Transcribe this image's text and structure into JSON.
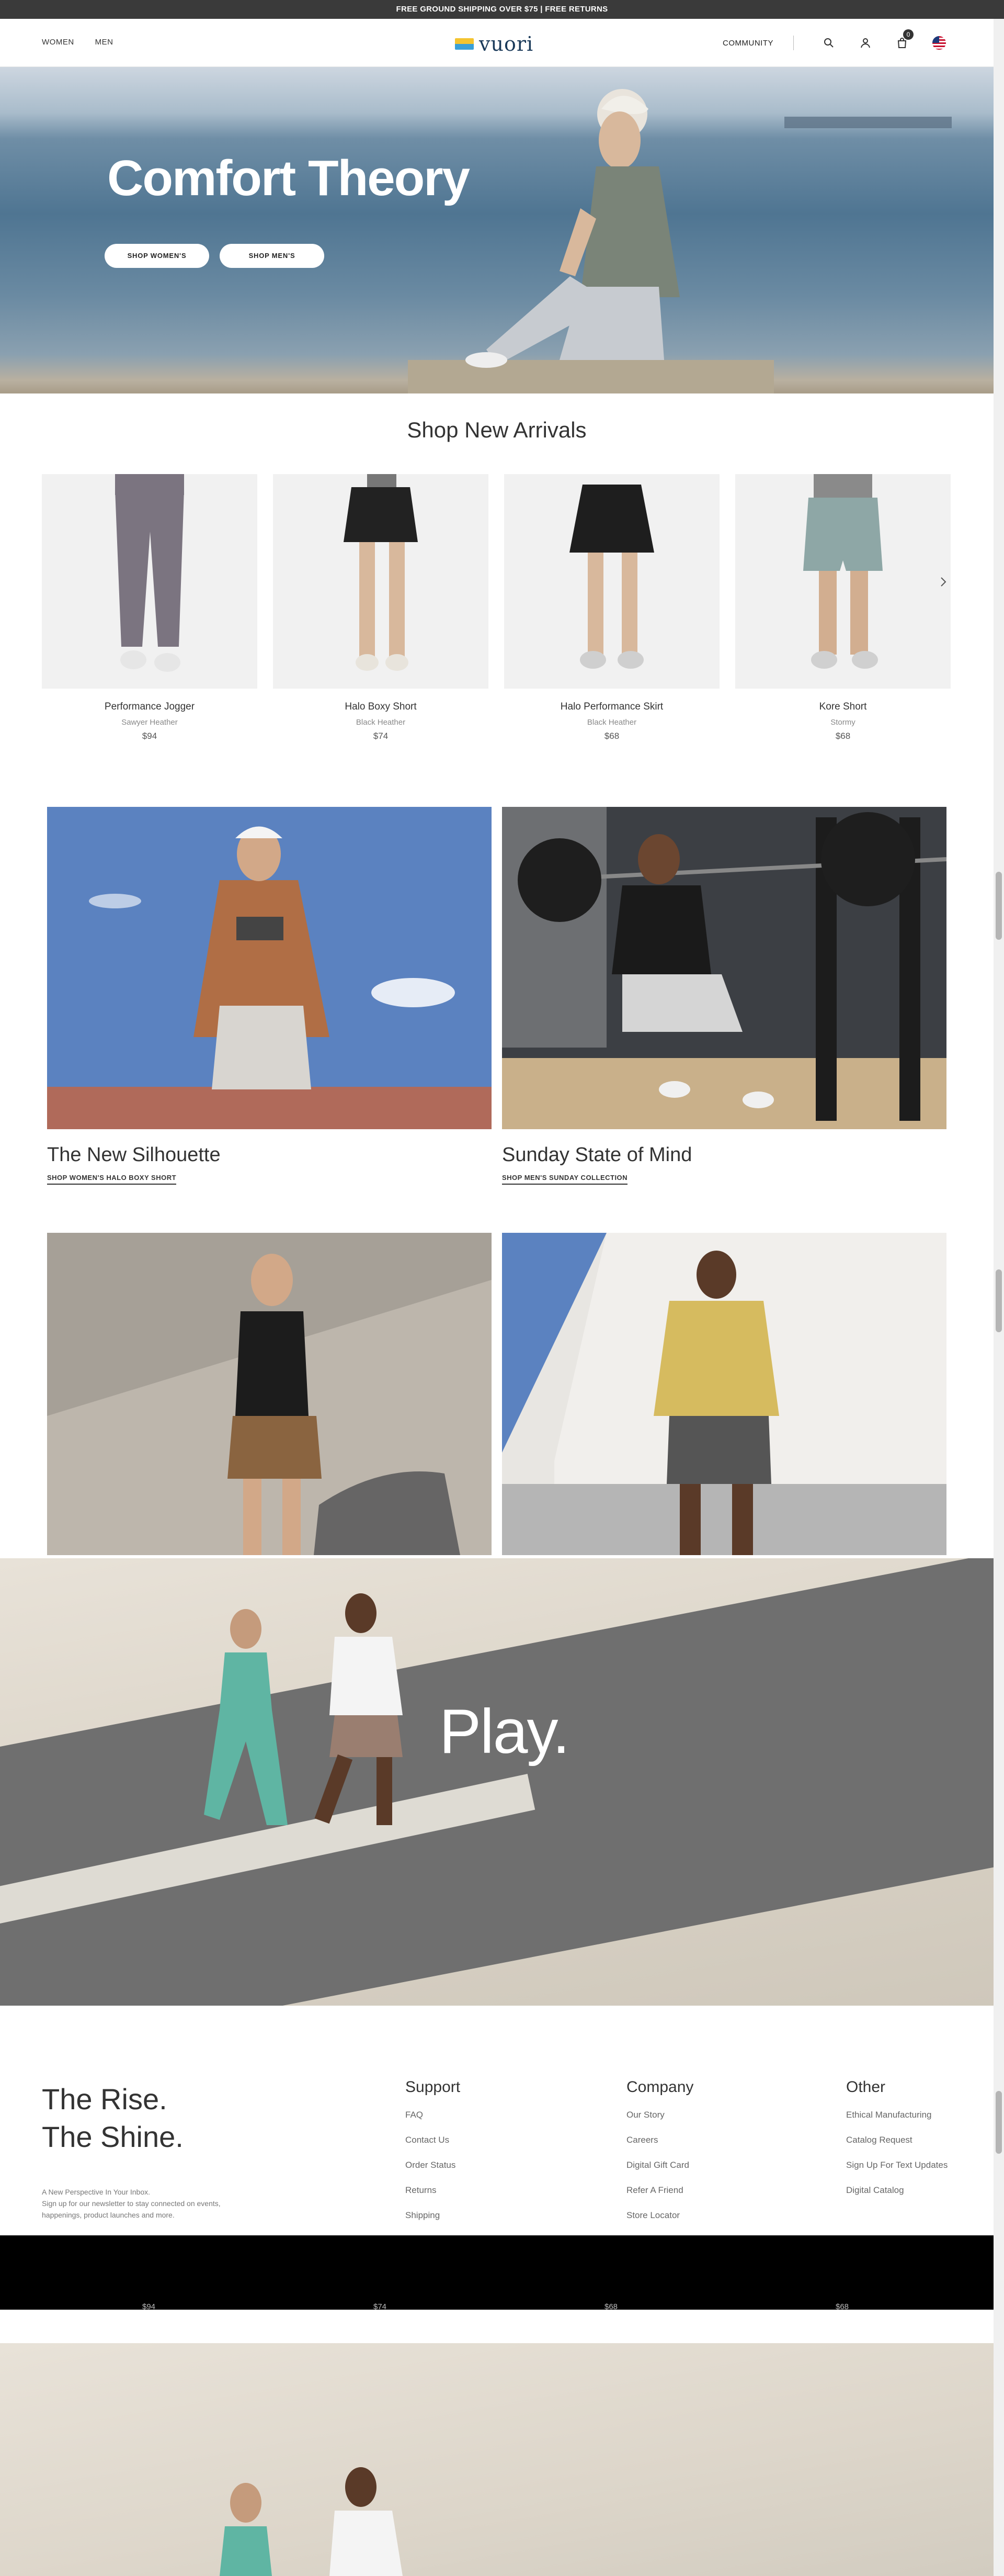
{
  "announcement": "FREE GROUND SHIPPING OVER $75 | FREE RETURNS",
  "nav": {
    "women": "WOMEN",
    "men": "MEN",
    "logo": "vuori",
    "community": "COMMUNITY",
    "cart_count": "0",
    "icons": [
      "search-icon",
      "account-icon",
      "cart-icon",
      "us-flag-icon"
    ]
  },
  "hero": {
    "title": "Comfort Theory",
    "btn_women": "SHOP WOMEN'S",
    "btn_men": "SHOP MEN'S"
  },
  "new_arrivals": {
    "title": "Shop New Arrivals",
    "products": [
      {
        "name": "Performance Jogger",
        "color": "Sawyer Heather",
        "price": "$94"
      },
      {
        "name": "Halo Boxy Short",
        "color": "Black Heather",
        "price": "$74"
      },
      {
        "name": "Halo Performance Skirt",
        "color": "Black Heather",
        "price": "$68"
      },
      {
        "name": "Kore Short",
        "color": "Stormy",
        "price": "$68"
      }
    ]
  },
  "editorial": [
    {
      "title": "The New Silhouette",
      "link": "SHOP WOMEN'S HALO BOXY SHORT"
    },
    {
      "title": "Sunday State of Mind",
      "link": "SHOP MEN'S SUNDAY COLLECTION"
    }
  ],
  "play": {
    "text": "Play."
  },
  "footer": {
    "tagline_1": "The Rise.",
    "tagline_2": "The Shine.",
    "copy_1": "A New Perspective In Your Inbox.",
    "copy_2": "Sign up for our newsletter to stay connected on events, happenings, product launches and more.",
    "support": {
      "title": "Support",
      "links": [
        "FAQ",
        "Contact Us",
        "Order Status",
        "Returns",
        "Shipping"
      ]
    },
    "company": {
      "title": "Company",
      "links": [
        "Our Story",
        "Careers",
        "Digital Gift Card",
        "Refer A Friend",
        "Store Locator"
      ]
    },
    "other": {
      "title": "Other",
      "links": [
        "Ethical Manufacturing",
        "Catalog Request",
        "Sign Up For Text Updates",
        "Digital Catalog"
      ]
    }
  },
  "ghost_prices": [
    "$94",
    "$74",
    "$68",
    "$68"
  ]
}
